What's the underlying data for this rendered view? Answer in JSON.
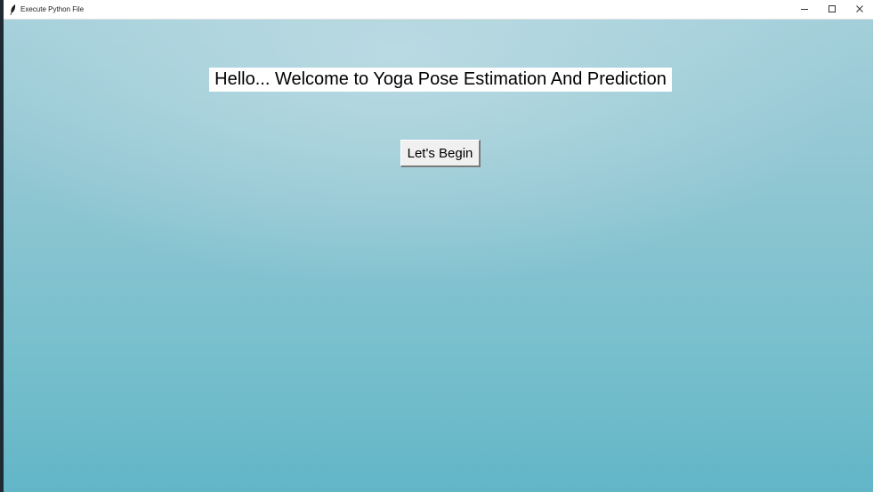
{
  "window": {
    "title": "Execute Python File",
    "app_icon": "feather-icon",
    "controls": {
      "minimize_icon": "minimize-icon",
      "maximize_icon": "maximize-icon",
      "close_icon": "close-icon"
    }
  },
  "main": {
    "heading": "Hello... Welcome to Yoga Pose Estimation And Prediction",
    "begin_button_label": "Let's Begin"
  },
  "colors": {
    "background_top": "#a3cfda",
    "background_bottom": "#62b6c7",
    "heading_bg": "#ffffff",
    "button_bg": "#f0f0f0"
  }
}
